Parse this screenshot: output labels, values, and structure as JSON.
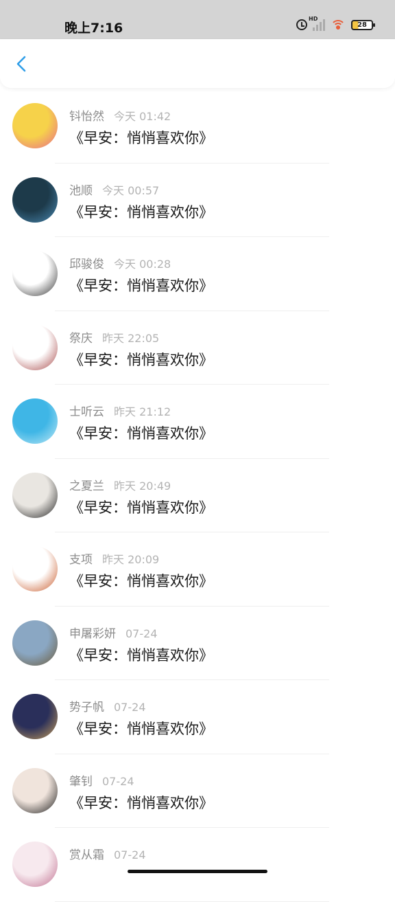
{
  "status_bar": {
    "time": "晚上7:16",
    "network_label": "HD",
    "battery_level": "28",
    "icons": [
      "alarm-icon",
      "signal-icon",
      "wifi-icon",
      "battery-icon"
    ]
  },
  "nav": {
    "back_icon": "chevron-left-icon",
    "accent_color": "#2f9ee8"
  },
  "items": [
    {
      "name": "钭怡然",
      "time": "今天 01:42",
      "message": "《早安：悄悄喜欢你》",
      "avatar": "cartoon-pink",
      "avatar_colors": [
        "#f6d24a",
        "#e86a8c"
      ]
    },
    {
      "name": "池顺",
      "time": "今天 00:57",
      "message": "《早安：悄悄喜欢你》",
      "avatar": "anime-boy-dark",
      "avatar_colors": [
        "#1d3a4a",
        "#4a8ab3"
      ]
    },
    {
      "name": "邱骏俊",
      "time": "今天 00:28",
      "message": "《早安：悄悄喜欢你》",
      "avatar": "manga-girl-sketch",
      "avatar_colors": [
        "#ffffff",
        "#333333"
      ]
    },
    {
      "name": "祭庆",
      "time": "昨天 22:05",
      "message": "《早安：悄悄喜欢你》",
      "avatar": "girl-red-coat",
      "avatar_colors": [
        "#ffffff",
        "#a84a4a"
      ]
    },
    {
      "name": "士听云",
      "time": "昨天 21:12",
      "message": "《早安：悄悄喜欢你》",
      "avatar": "paper-plane-sky",
      "avatar_colors": [
        "#3fb6e6",
        "#bfe8f5"
      ]
    },
    {
      "name": "之夏兰",
      "time": "昨天 20:49",
      "message": "《早安：悄悄喜欢你》",
      "avatar": "man-photo",
      "avatar_colors": [
        "#e9e6e1",
        "#222222"
      ]
    },
    {
      "name": "支项",
      "time": "昨天 20:09",
      "message": "《早安：悄悄喜欢你》",
      "avatar": "girl-orange-hair",
      "avatar_colors": [
        "#ffffff",
        "#c85a2a"
      ]
    },
    {
      "name": "申屠彩妍",
      "time": "07-24",
      "message": "《早安：悄悄喜欢你》",
      "avatar": "mountain-lake",
      "avatar_colors": [
        "#8aa7c3",
        "#6b5a3a"
      ]
    },
    {
      "name": "势子帆",
      "time": "07-24",
      "message": "《早安：悄悄喜欢你》",
      "avatar": "city-street-night",
      "avatar_colors": [
        "#2a2f5a",
        "#c8a05a"
      ]
    },
    {
      "name": "肇钊",
      "time": "07-24",
      "message": "《早安：悄悄喜欢你》",
      "avatar": "boy-photo",
      "avatar_colors": [
        "#f0e4dc",
        "#1a1a1a"
      ]
    },
    {
      "name": "赏从霜",
      "time": "07-24",
      "message": "",
      "avatar": "girl-pink-blur",
      "avatar_colors": [
        "#f7e9ee",
        "#c07090"
      ]
    }
  ]
}
